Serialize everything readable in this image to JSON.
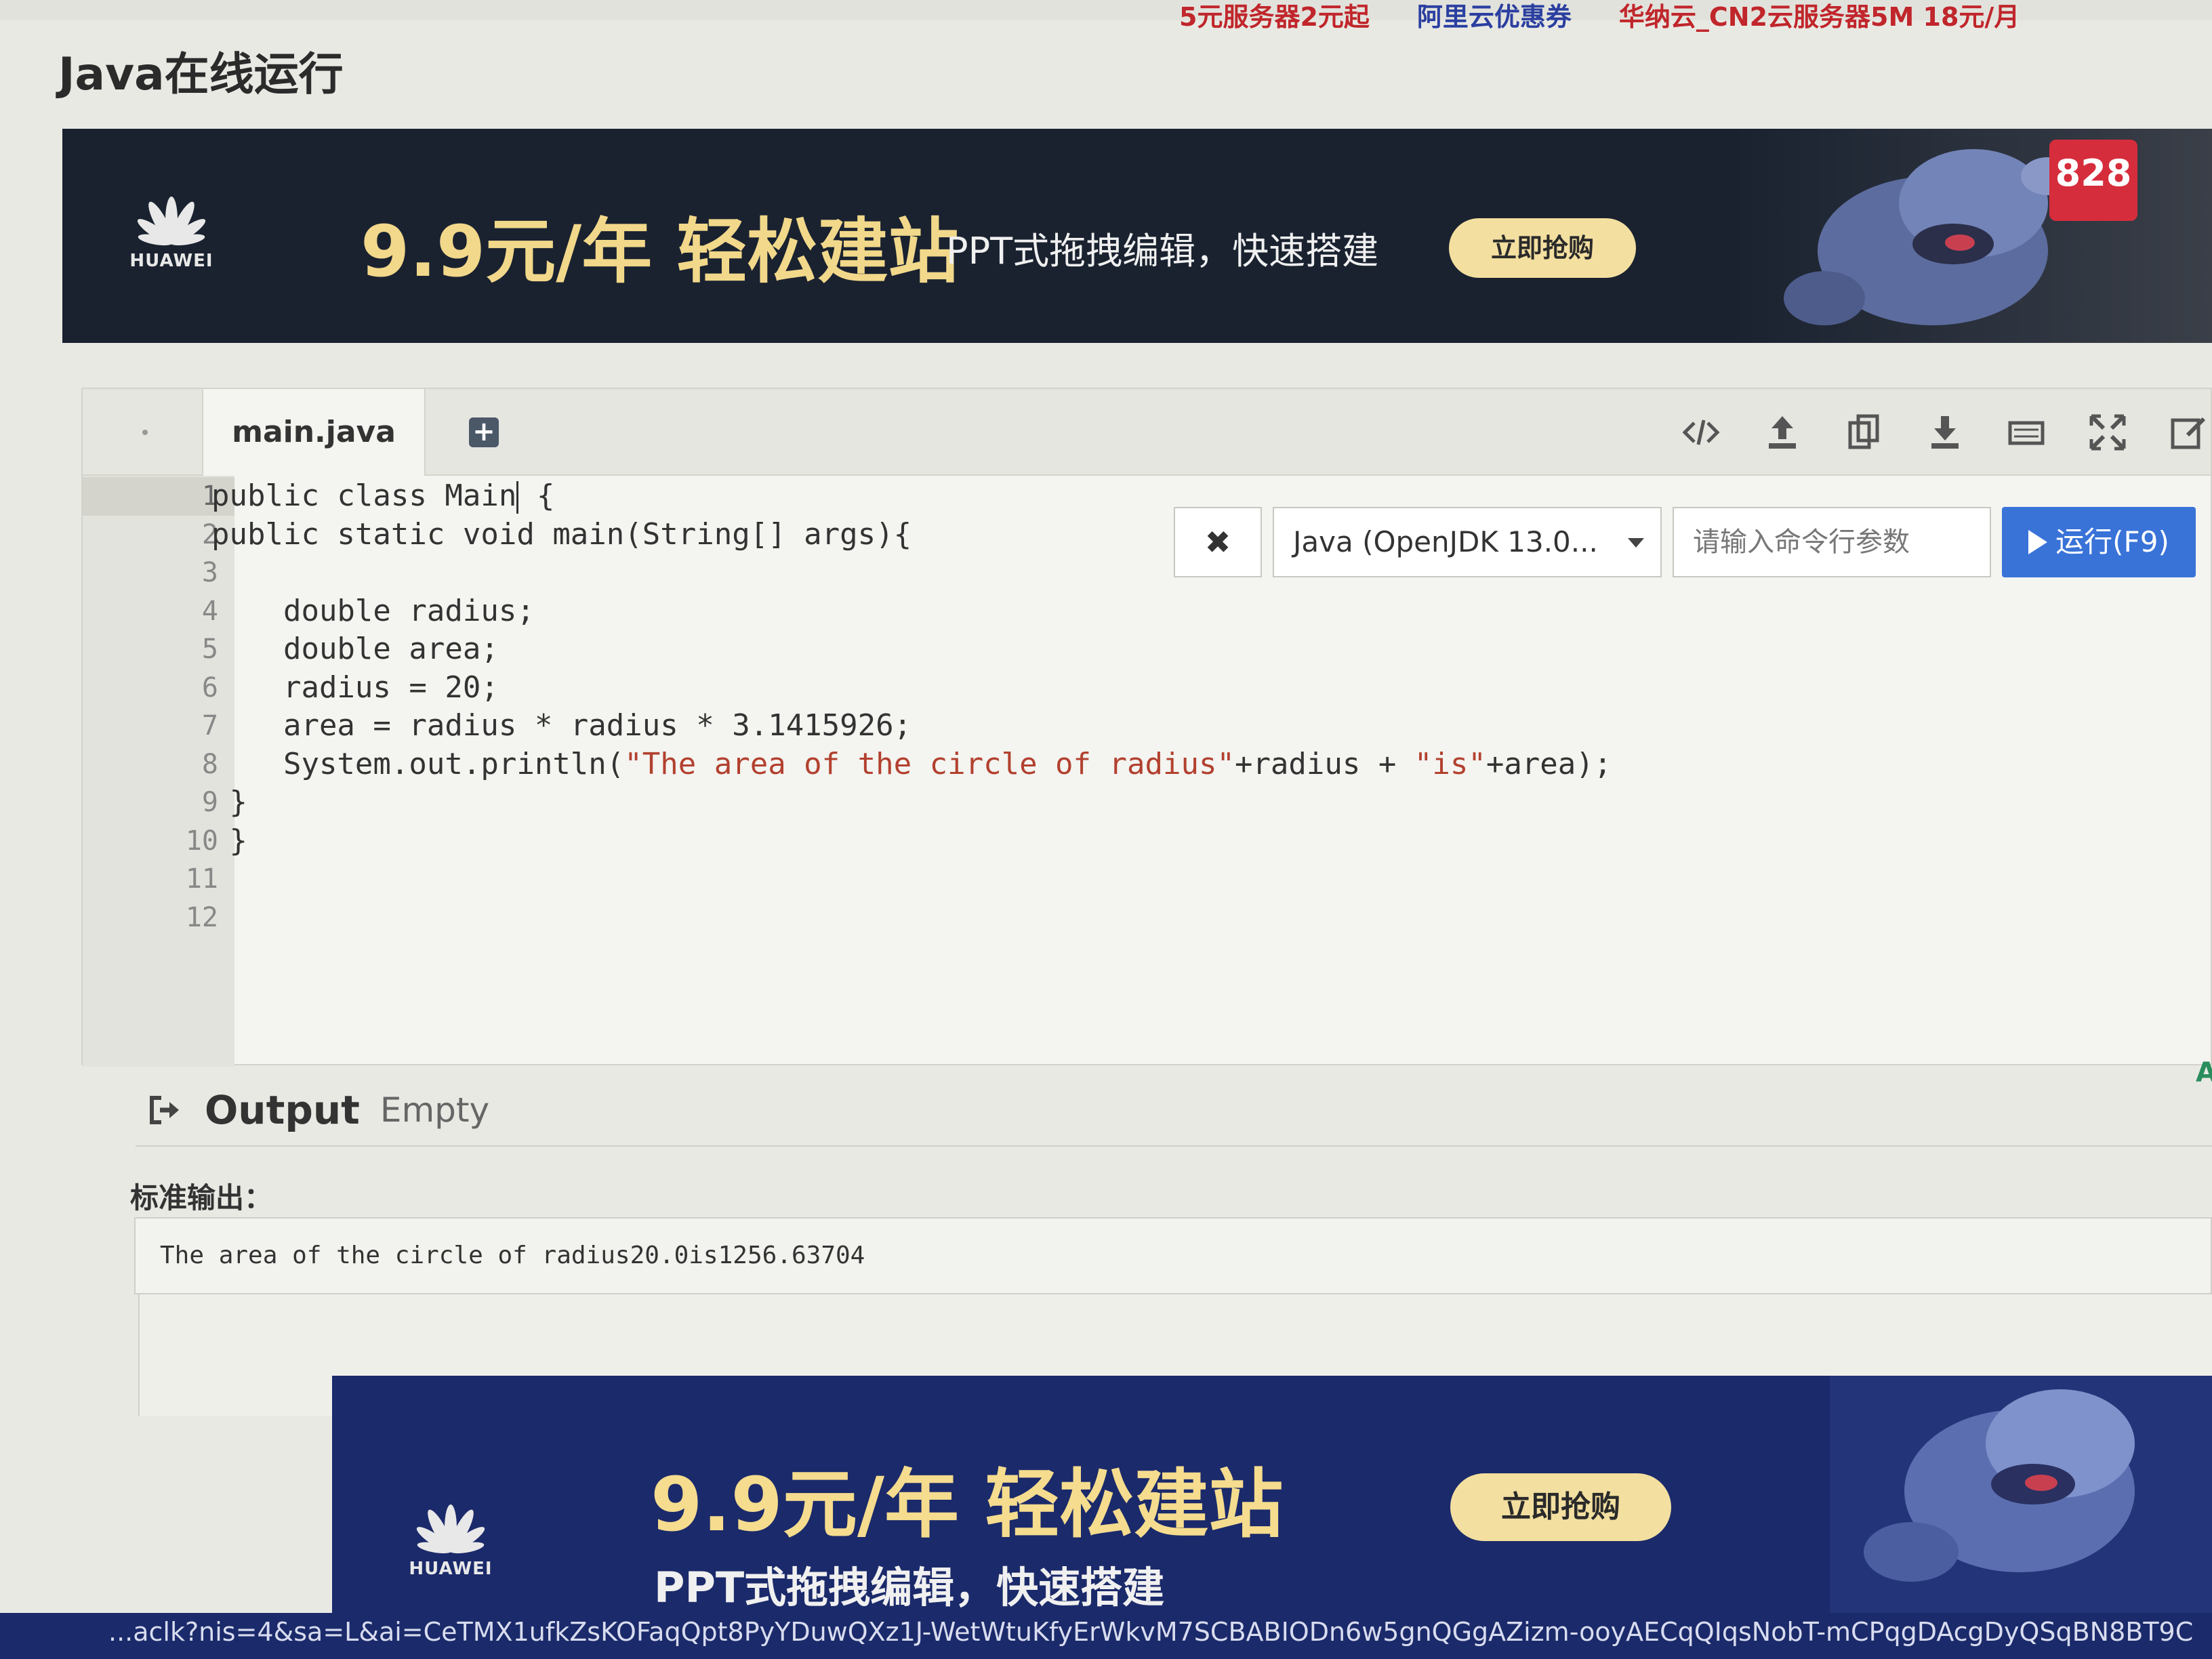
{
  "top_links": [
    {
      "text": "5元服务器2元起",
      "color": "#c0262b"
    },
    {
      "text": "阿里云优惠券",
      "color": "#2a3fa0"
    },
    {
      "text": "华纳云_CN2云服务器5M 18元/月",
      "color": "#c0262b"
    }
  ],
  "page": {
    "title": "Java在线运行"
  },
  "banner_top": {
    "brand": "HUAWEI",
    "price": "9.9元/年 轻松建站",
    "subtitle": "PPT式拖拽编辑，快速搭建",
    "cta": "立即抢购",
    "badge": "828"
  },
  "editor": {
    "tab_label": "main.java",
    "add_tab_icon": "plus-square-icon",
    "toolbar_icons": [
      "code-icon",
      "upload-icon",
      "copy-icon",
      "download-icon",
      "keyboard-icon",
      "fullscreen-icon",
      "edit-icon"
    ],
    "line_numbers": [
      "1",
      "2",
      "3",
      "4",
      "5",
      "6",
      "7",
      "8",
      "9",
      "10",
      "11",
      "12"
    ],
    "code": {
      "l1": "public class Main",
      "l1b": " {",
      "l2": "public static void main(String[] args){",
      "l3": "",
      "l4": "    double radius;",
      "l5": "    double area;",
      "l6": "    radius = 20;",
      "l7": "    area = radius * radius * 3.1415926;",
      "l8a": "    System.out.println(",
      "l8b": "\"The area of the circle of radius\"",
      "l8c": "+radius + ",
      "l8d": "\"is\"",
      "l8e": "+area);",
      "l9": " }",
      "l10": " }",
      "l11": "",
      "l12": ""
    }
  },
  "run_controls": {
    "clear_label": "✖",
    "language_selected": "Java (OpenJDK 13.0...",
    "args_placeholder": "请输入命令行参数",
    "run_label": "运行(F9)"
  },
  "output": {
    "title": "Output",
    "status": "Empty",
    "stdout_label": "标准输出：",
    "stdout_text": "The area of the circle of radius20.0is1256.63704"
  },
  "banner_bottom": {
    "brand": "HUAWEI",
    "price": "9.9元/年 轻松建站",
    "subtitle": "PPT式拖拽编辑，快速搭建",
    "cta": "立即抢购"
  },
  "status_url": "...aclk?nis=4&sa=L&ai=CeTMX1ufkZsKOFaqQpt8PyYDuwQXz1J-WetWtuKfyErWkvM7SCBABIODn6w5gnQGgAZizm-ooyAECqQIqsNobT-mCPqgDAcgDyQSqBN8BT9C",
  "side_letter": "A",
  "colors": {
    "accent_run": "#3973d8",
    "banner_gold": "#f2d88a",
    "banner_dark": "#1a2230",
    "banner_blue": "#1b2a6a"
  }
}
